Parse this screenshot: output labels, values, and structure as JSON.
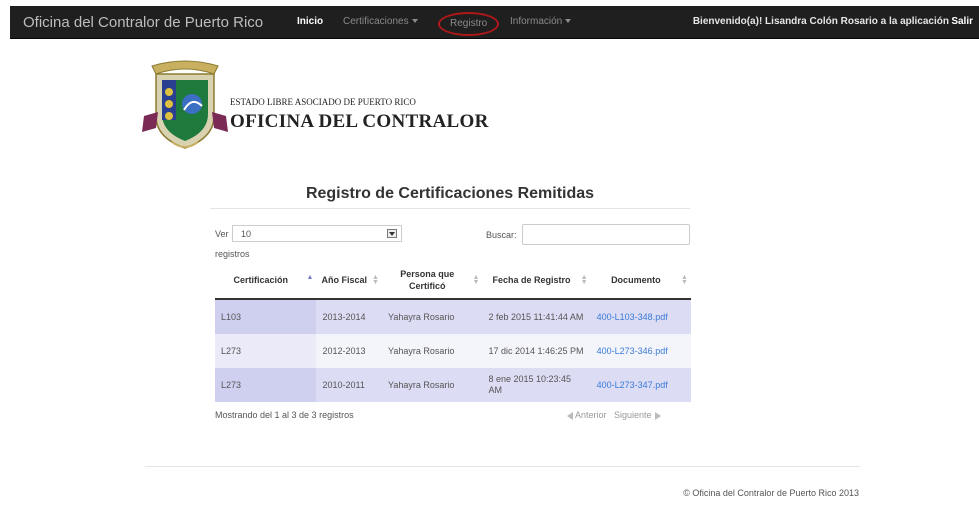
{
  "navbar": {
    "brand": "Oficina del Contralor de Puerto Rico",
    "items": [
      {
        "label": "Inicio"
      },
      {
        "label": "Certificaciones"
      },
      {
        "label": "Registro"
      },
      {
        "label": "Información"
      }
    ],
    "welcome": "Bienvenido(a)! Lisandra Colón Rosario a la aplicación",
    "logout": "Salir"
  },
  "header": {
    "line1": "ESTADO LIBRE ASOCIADO DE PUERTO RICO",
    "line2": "OFICINA DEL CONTRALOR"
  },
  "page": {
    "title": "Registro de Certificaciones Remitidas"
  },
  "controls": {
    "show_label": "Ver",
    "page_size": "10",
    "records_label": "registros",
    "search_label": "Buscar:",
    "search_value": ""
  },
  "table": {
    "columns": [
      "Certificación",
      "Año Fiscal",
      "Persona que Certificó",
      "Fecha de Registro",
      "Documento"
    ],
    "rows": [
      [
        "L103",
        "2013-2014",
        "Yahayra Rosario",
        "2 feb 2015 11:41:44 AM",
        "400-L103-348.pdf"
      ],
      [
        "L273",
        "2012-2013",
        "Yahayra Rosario",
        "17 dic 2014 1:46:25 PM",
        "400-L273-346.pdf"
      ],
      [
        "L273",
        "2010-2011",
        "Yahayra Rosario",
        "8 ene 2015 10:23:45 AM",
        "400-L273-347.pdf"
      ]
    ]
  },
  "pagination": {
    "info": "Mostrando del 1 al 3 de 3 registros",
    "previous": "Anterior",
    "next": "Siguiente"
  },
  "footer": {
    "text": "© Oficina del Contralor de Puerto Rico 2013"
  },
  "colors": {
    "navbar_bg": "#1f1f1f",
    "circle_highlight": "#b01818",
    "row_odd": "#dcdcf4",
    "link": "#3a7bd5"
  }
}
